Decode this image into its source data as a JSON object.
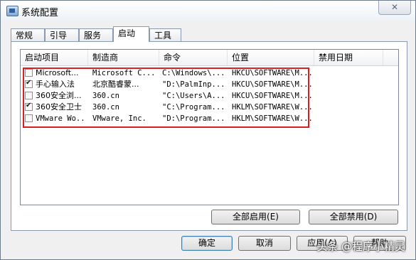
{
  "window": {
    "title": "系统配置",
    "close_glyph": "✕"
  },
  "tabs": [
    {
      "label": "常规"
    },
    {
      "label": "引导"
    },
    {
      "label": "服务"
    },
    {
      "label": "启动"
    },
    {
      "label": "工具"
    }
  ],
  "active_tab": "启动",
  "table": {
    "columns": [
      "启动项目",
      "制造商",
      "命令",
      "位置",
      "禁用日期"
    ],
    "rows": [
      {
        "checked": false,
        "item": "Microsoft...",
        "maker": "Microsoft C...",
        "command": "C:\\Windows\\...",
        "location": "HKCU\\SOFTWARE\\M...",
        "date": ""
      },
      {
        "checked": true,
        "item": "手心输入法",
        "maker": "北京酷睿蒙...",
        "command": "\"D:\\PalmInp...",
        "location": "HKCU\\SOFTWARE\\M...",
        "date": ""
      },
      {
        "checked": false,
        "item": "360安全浏...",
        "maker": "360.cn",
        "command": "\"C:\\Users\\A...",
        "location": "HKCU\\SOFTWARE\\M...",
        "date": ""
      },
      {
        "checked": true,
        "item": "360安全卫士",
        "maker": "360.cn",
        "command": "\"C:\\Program...",
        "location": "HKLM\\SOFTWARE\\W...",
        "date": ""
      },
      {
        "checked": false,
        "item": "VMware Wo...",
        "maker": "VMware, Inc.",
        "command": "\"D:\\Program...",
        "location": "HKLM\\SOFTWARE\\W...",
        "date": ""
      }
    ]
  },
  "panel_buttons": {
    "enable_all": "全部启用(E)",
    "disable_all": "全部禁用(D)"
  },
  "dialog_buttons": {
    "ok": "确定",
    "cancel": "取消",
    "apply": "应用(A)",
    "help": "帮助"
  },
  "watermark": "头条 @程序小精灵",
  "colors": {
    "highlight_border": "#d81e20",
    "default_button_border": "#3c7fb1"
  }
}
